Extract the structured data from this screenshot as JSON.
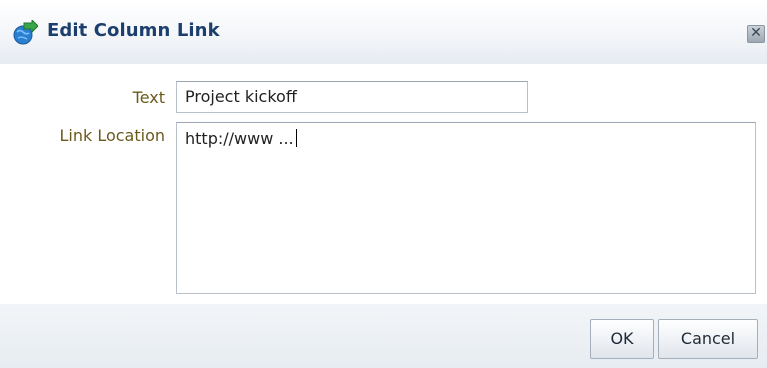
{
  "dialog": {
    "title": "Edit Column Link",
    "close_label": "✕"
  },
  "form": {
    "text_label": "Text",
    "text_value": "Project kickoff",
    "link_label": "Link Location",
    "link_value": "http://www ..."
  },
  "buttons": {
    "ok_label": "OK",
    "cancel_label": "Cancel"
  },
  "colors": {
    "title": "#1c3f6e",
    "label": "#6b5a1e",
    "icon_globe": "#2a7fd0",
    "icon_arrow": "#3aa64a"
  }
}
